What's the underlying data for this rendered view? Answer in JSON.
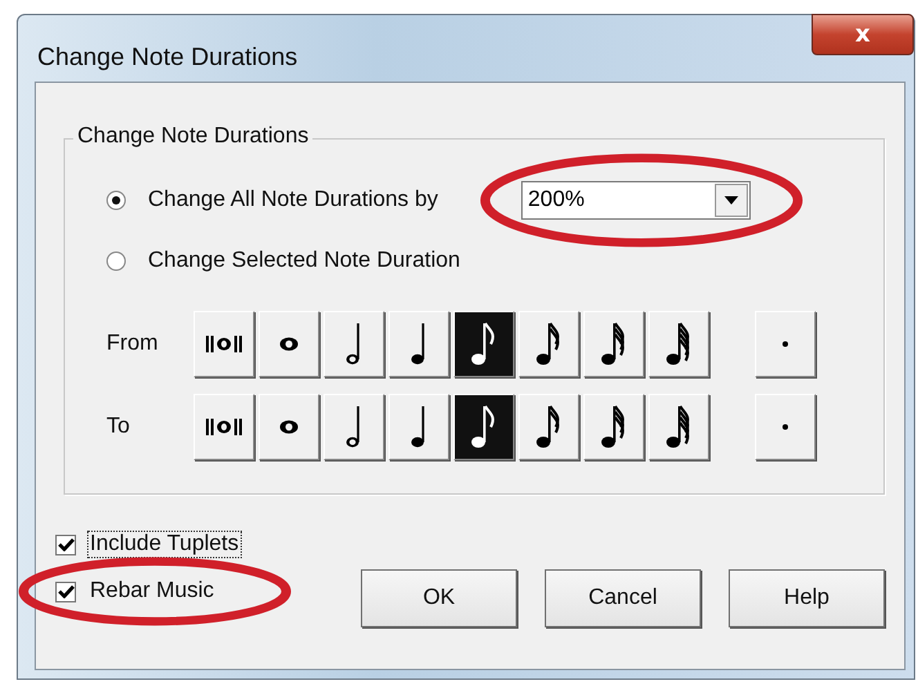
{
  "window": {
    "title": "Change Note Durations",
    "close_label": "x"
  },
  "group": {
    "title": "Change Note Durations"
  },
  "options": [
    {
      "label": "Change All Note Durations by",
      "selected": true,
      "dropdown": {
        "value": "200%",
        "circled": true
      }
    },
    {
      "label": "Change Selected Note Duration",
      "selected": false
    }
  ],
  "rows": [
    {
      "label": "From",
      "notes": [
        {
          "kind": "breve",
          "selected": false
        },
        {
          "kind": "whole",
          "selected": false
        },
        {
          "kind": "half",
          "selected": false
        },
        {
          "kind": "quarter",
          "selected": false
        },
        {
          "kind": "eighth",
          "selected": true
        },
        {
          "kind": "sixteenth",
          "selected": false
        },
        {
          "kind": "thirty_second",
          "selected": false
        },
        {
          "kind": "sixty_fourth",
          "selected": false
        },
        {
          "kind": "dot",
          "selected": false
        }
      ]
    },
    {
      "label": "To",
      "notes": [
        {
          "kind": "breve",
          "selected": false
        },
        {
          "kind": "whole",
          "selected": false
        },
        {
          "kind": "half",
          "selected": false
        },
        {
          "kind": "quarter",
          "selected": false
        },
        {
          "kind": "eighth",
          "selected": true
        },
        {
          "kind": "sixteenth",
          "selected": false
        },
        {
          "kind": "thirty_second",
          "selected": false
        },
        {
          "kind": "sixty_fourth",
          "selected": false
        },
        {
          "kind": "dot",
          "selected": false
        }
      ]
    }
  ],
  "checkboxes": [
    {
      "label": "Include Tuplets",
      "checked": true,
      "focused": true,
      "circled": false
    },
    {
      "label": "Rebar Music",
      "checked": true,
      "focused": false,
      "circled": true
    }
  ],
  "buttons": [
    "OK",
    "Cancel",
    "Help"
  ]
}
